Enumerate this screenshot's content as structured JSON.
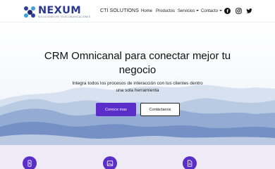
{
  "brand": {
    "name": "NEXUM",
    "tagline": "SOLUCIONES EN TELECOMUNICACIONES",
    "colors": {
      "primary": "#2b3990",
      "accent": "#5b2ec9"
    }
  },
  "nav": {
    "cti": "CTI SOLUTIONS",
    "home": "Home",
    "productos": "Productos",
    "servicios": "Servicios",
    "contacto": "Contacto",
    "social": [
      "facebook-icon",
      "instagram-icon",
      "twitter-icon"
    ]
  },
  "hero": {
    "title_line1": "CRM Omnicanal para conectar mejor tu",
    "title_line2": "negocio",
    "subtitle_line1": "Integra todos los procesos de interacción con tus clientes dentro",
    "subtitle_line2": "una sola herramienta",
    "primary_button": "Conoce mas",
    "secondary_button": "Contáctanos"
  },
  "features": {
    "icons": [
      "mobile-icon",
      "image-icon",
      "document-icon"
    ]
  }
}
